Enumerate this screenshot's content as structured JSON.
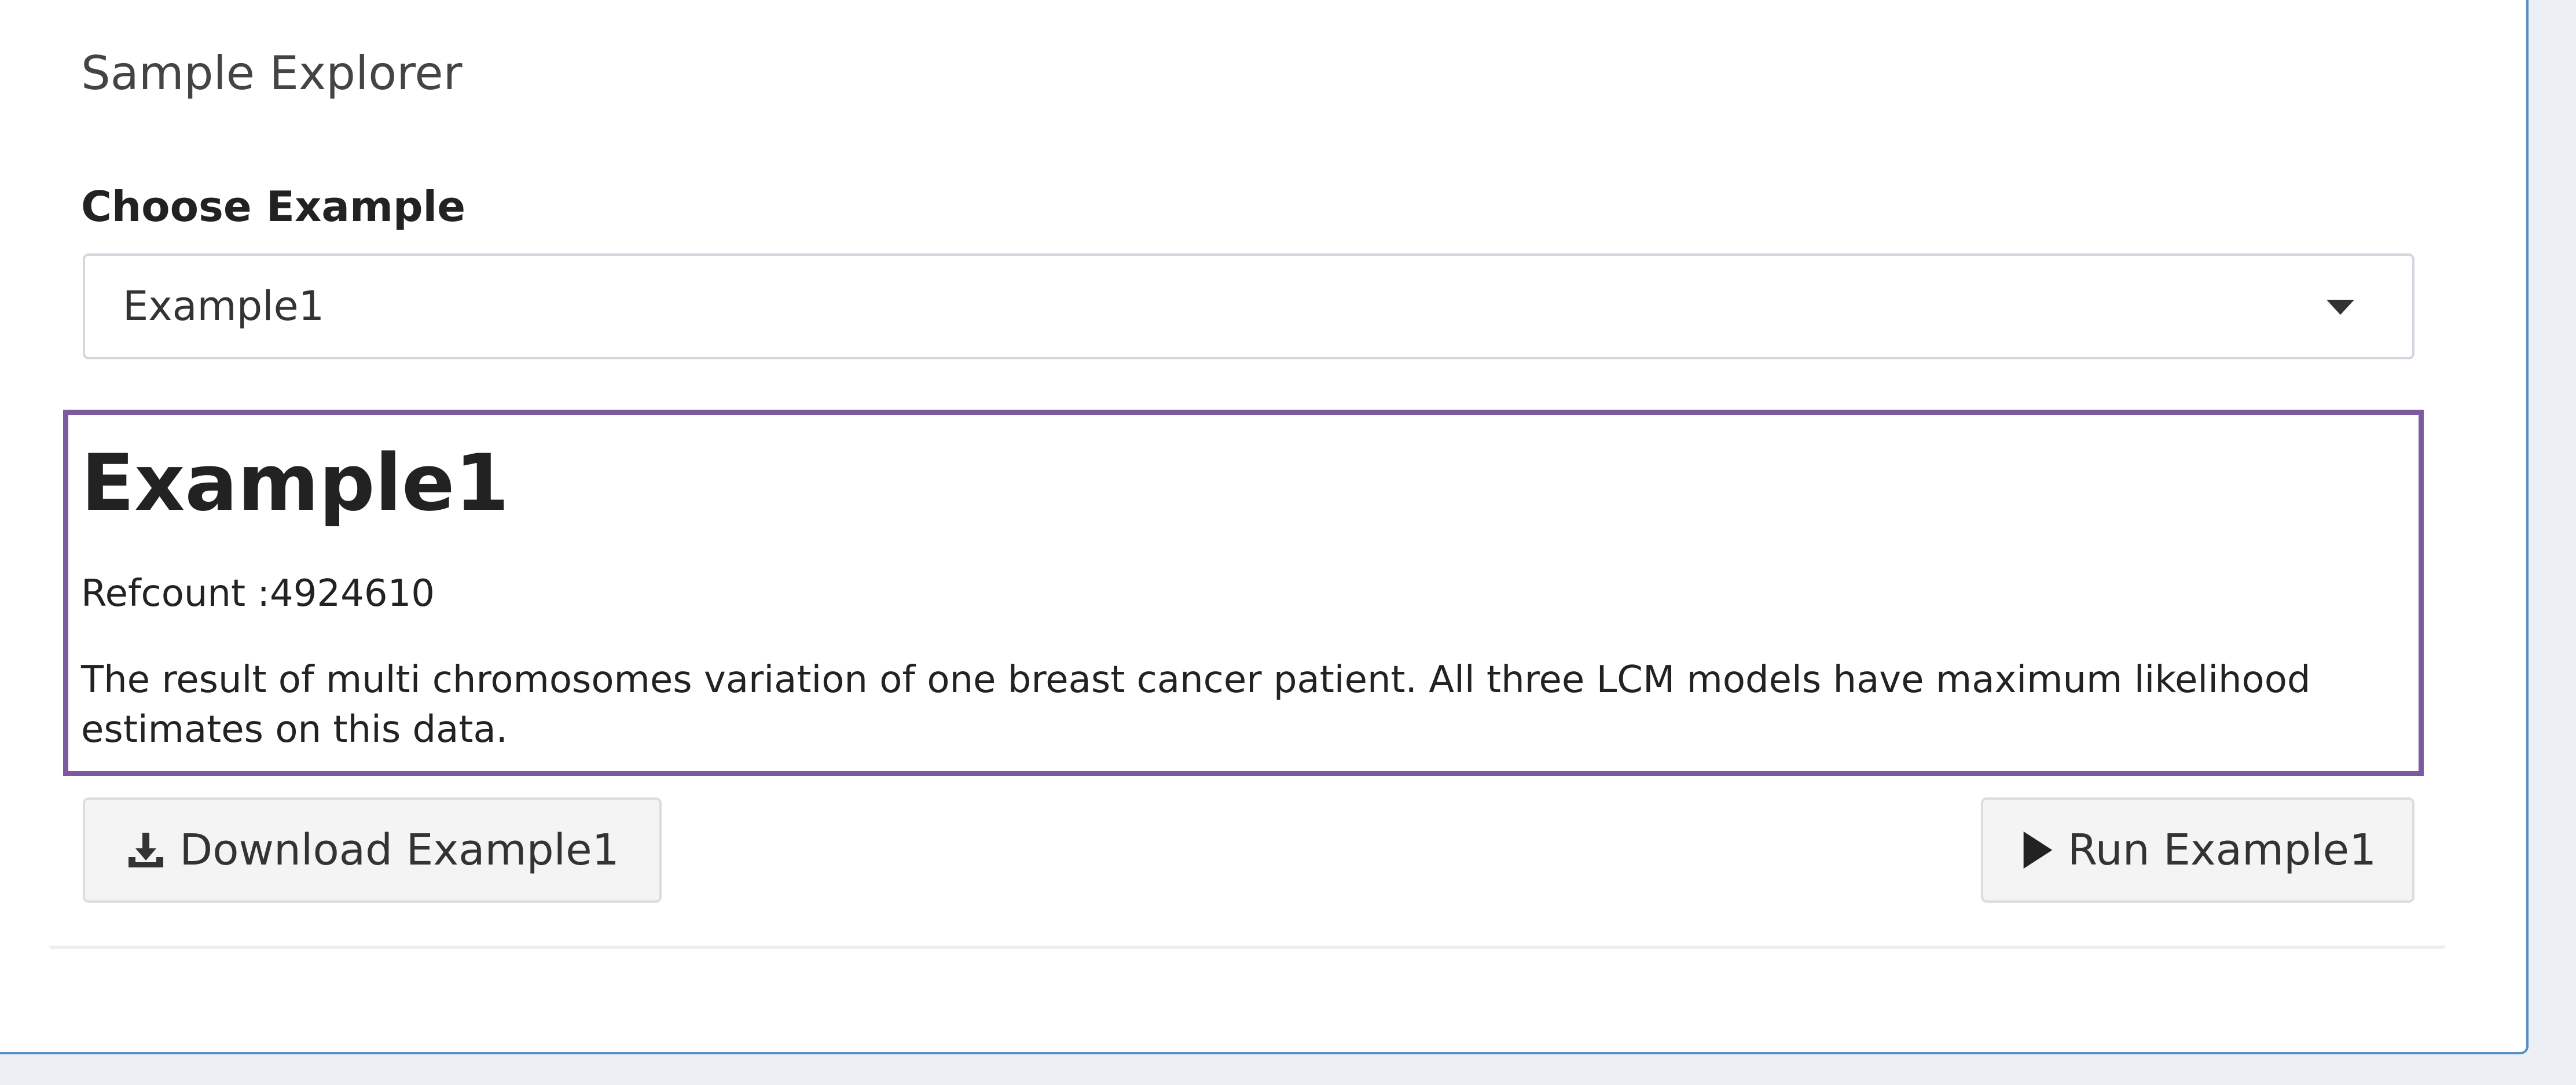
{
  "panel": {
    "title": "Sample Explorer",
    "accent_color": "#f39c12"
  },
  "chooser": {
    "label": "Choose Example",
    "selected": "Example1"
  },
  "info": {
    "heading": "Example1",
    "refcount": "Refcount :4924610",
    "description": "The result of multi chromosomes variation of one breast cancer patient. All three LCM models have maximum likelihood estimates on this data.",
    "border_color": "#7d5a9e"
  },
  "actions": {
    "download_label": "Download Example1",
    "download_icon": "download-icon",
    "run_label": "Run Example1",
    "run_icon": "play-icon"
  }
}
